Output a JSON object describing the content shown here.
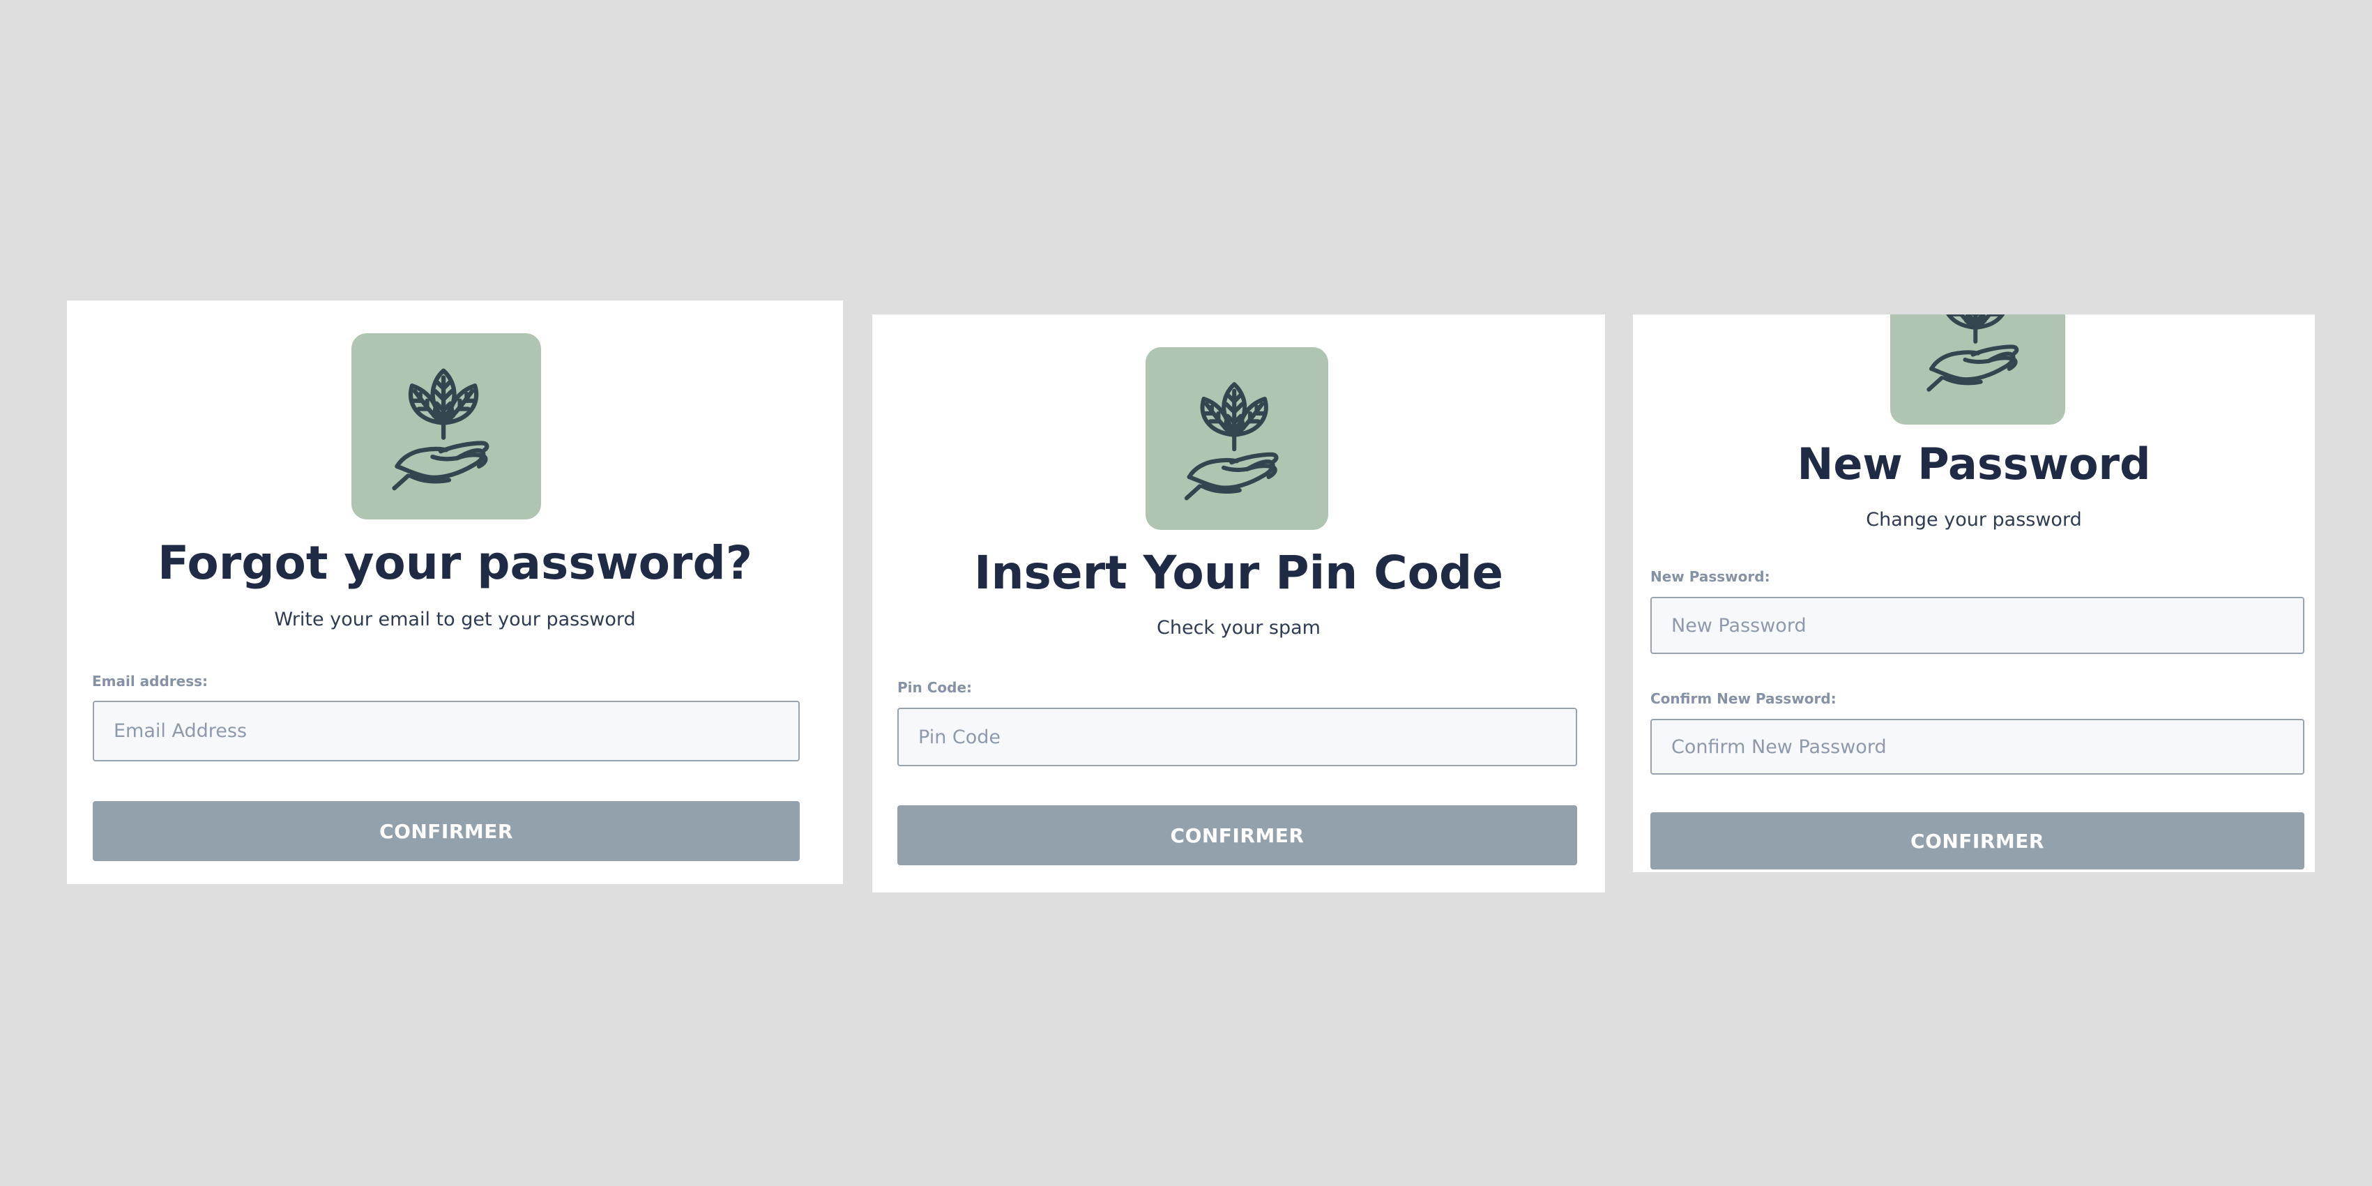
{
  "forgot_password": {
    "logo_icon": "plant-in-hand-icon",
    "title": "Forgot your password?",
    "subtitle": "Write your email to get your password",
    "email_label": "Email address:",
    "email_placeholder": "Email Address",
    "email_value": "",
    "confirm_label": "CONFIRMER"
  },
  "pin_code": {
    "logo_icon": "plant-in-hand-icon",
    "title": "Insert Your Pin Code",
    "subtitle": "Check your spam",
    "pin_label": "Pin Code:",
    "pin_placeholder": "Pin Code",
    "pin_value": "",
    "confirm_label": "CONFIRMER"
  },
  "new_password": {
    "logo_icon": "plant-in-hand-icon",
    "title": "New Password",
    "subtitle": "Change your password",
    "new_password_label": "New Password:",
    "new_password_placeholder": "New Password",
    "new_password_value": "",
    "confirm_password_label": "Confirm New Password:",
    "confirm_password_placeholder": "Confirm New Password",
    "confirm_password_value": "",
    "confirm_label": "CONFIRMER"
  },
  "colors": {
    "page_background": "#dedede",
    "card_background": "#ffffff",
    "logo_background": "#afc5b2",
    "logo_stroke": "#33454f",
    "title_text": "#1f2a44",
    "label_text": "#8592a5",
    "input_background": "#f6f8fb",
    "input_border": "#99a3b0",
    "button_background": "#93a1ad",
    "button_text": "#ffffff"
  }
}
